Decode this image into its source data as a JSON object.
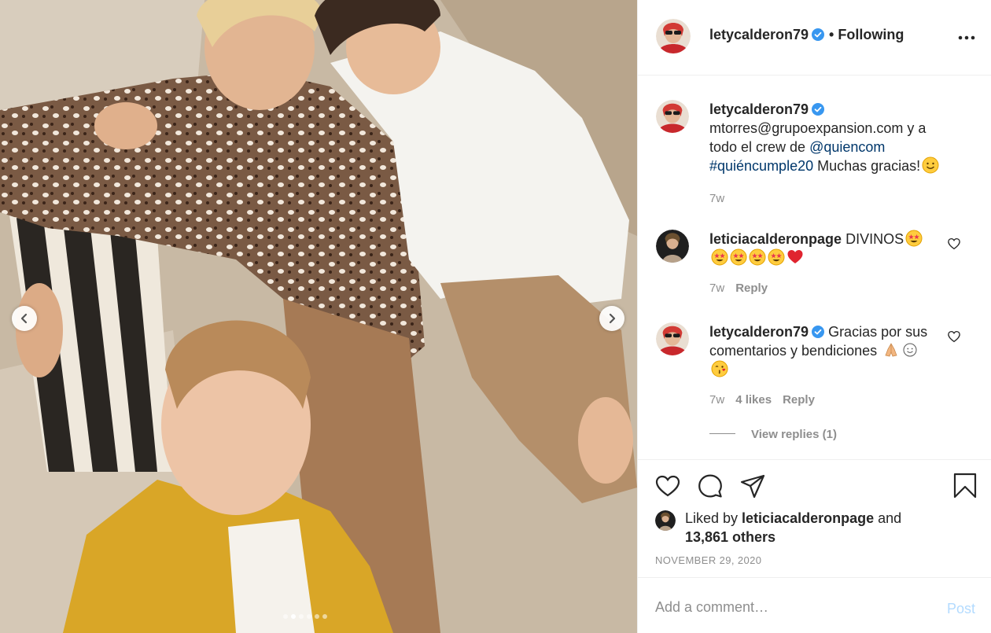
{
  "post": {
    "username": "letycalderon79",
    "verified": true,
    "follow_separator": "•",
    "follow_status": "Following",
    "more_icon": "more-horizontal-icon",
    "carousel": {
      "total": 6,
      "active": 2
    }
  },
  "caption": {
    "username": "letycalderon79",
    "text_line1": "mtorres@grupoexpansion.com y a",
    "text_line2_prefix": "todo el crew de ",
    "mention": "@quiencom",
    "hashtag": "#quiéncumple20",
    "text_suffix": " Muchas gracias!",
    "emoji": "smiling-face-icon",
    "time": "7w"
  },
  "comments": [
    {
      "username": "leticiacalderonpage",
      "text": " DIVINOS",
      "emoji": "star-struck-emoji x5, red-heart-emoji",
      "time": "7w",
      "reply": "Reply"
    },
    {
      "username": "letycalderon79",
      "text_line1": " Gracias por sus",
      "text_line2": "comentarios y bendiciones",
      "emoji": "folded-hands-emoji, smiling-face-emoji, face-blowing-kiss-emoji",
      "time": "7w",
      "likes": "4 likes",
      "reply": "Reply",
      "view_replies": "View replies (1)"
    }
  ],
  "likes": {
    "prefix": "Liked by ",
    "user": "leticiacalderonpage",
    "and": " and",
    "others": "13,861 others"
  },
  "date": "NOVEMBER 29, 2020",
  "add_comment": {
    "placeholder": "Add a comment…",
    "post_label": "Post"
  },
  "colors": {
    "link": "#00376b",
    "muted": "#8e8e8e",
    "post_disabled": "#b3dbff",
    "verified": "#3897f0",
    "heart": "#ed4956"
  }
}
